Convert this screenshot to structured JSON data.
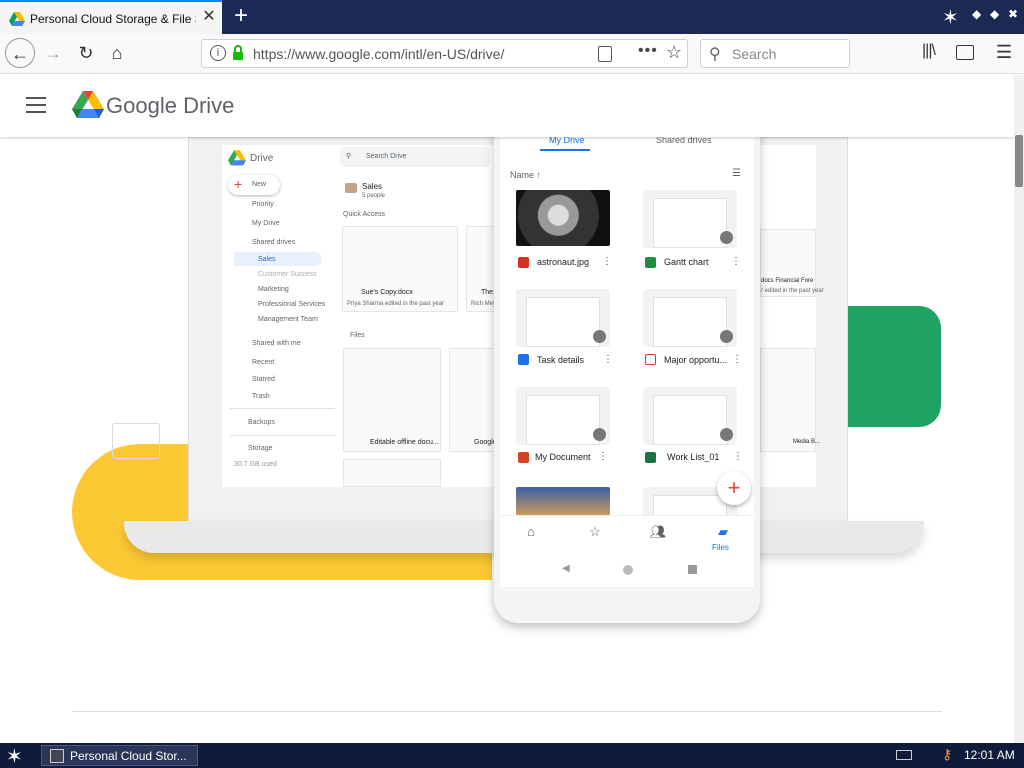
{
  "browser": {
    "tab_title": "Personal Cloud Storage & File Sha",
    "url": "https://www.google.com/intl/en-US/drive/",
    "search_placeholder": "Search"
  },
  "header": {
    "brand_google": "Google",
    "brand_drive": "Drive"
  },
  "laptop_ui": {
    "app_name": "Drive",
    "search_placeholder": "Search Drive",
    "new_button": "New",
    "nav": [
      "Priority",
      "My Drive",
      "Shared drives",
      "Sales",
      "Customer Success",
      "Marketing",
      "Professional Services",
      "Management Team",
      "Shared with me",
      "Recent",
      "Starred",
      "Trash",
      "Backups",
      "Storage"
    ],
    "storage_used": "30.7 GB used",
    "folder_name": "Sales",
    "folder_people": "5 people",
    "quick_access": "Quick Access",
    "files": "Files",
    "qa_cards": [
      {
        "title": "Sue's Copy.docx",
        "sub": "Priya Sharma edited in the past year"
      },
      {
        "title": "The...",
        "sub": "Rich Mey..."
      }
    ],
    "file_cards": [
      {
        "title": "Editable offline docu..."
      },
      {
        "title": "Google..."
      }
    ],
    "right_cards": [
      {
        "title": "docs Financial Fore",
        "sub": "r edited in the past year"
      },
      {
        "title": "Media B..."
      }
    ]
  },
  "phone": {
    "tab_mydrive": "My Drive",
    "tab_shared": "Shared drives",
    "sort_label": "Name ↑",
    "files": [
      {
        "name": "astronaut.jpg",
        "type_color": "#d93025"
      },
      {
        "name": "Gantt chart",
        "type_color": "#1e8e3e"
      },
      {
        "name": "Task details",
        "type_color": "#1a73e8"
      },
      {
        "name": "Major opportu...",
        "type_color": "#d93025"
      },
      {
        "name": "My Document",
        "type_color": "#d04423"
      },
      {
        "name": "Work List_01",
        "type_color": "#1e7145"
      }
    ],
    "nav_files_label": "Files"
  },
  "taskbar": {
    "window_label": "Personal Cloud Stor...",
    "clock": "12:01 AM"
  },
  "colors": {
    "yellow": "#fcc934",
    "green": "#1ea362",
    "accent_blue": "#1a73e8"
  }
}
